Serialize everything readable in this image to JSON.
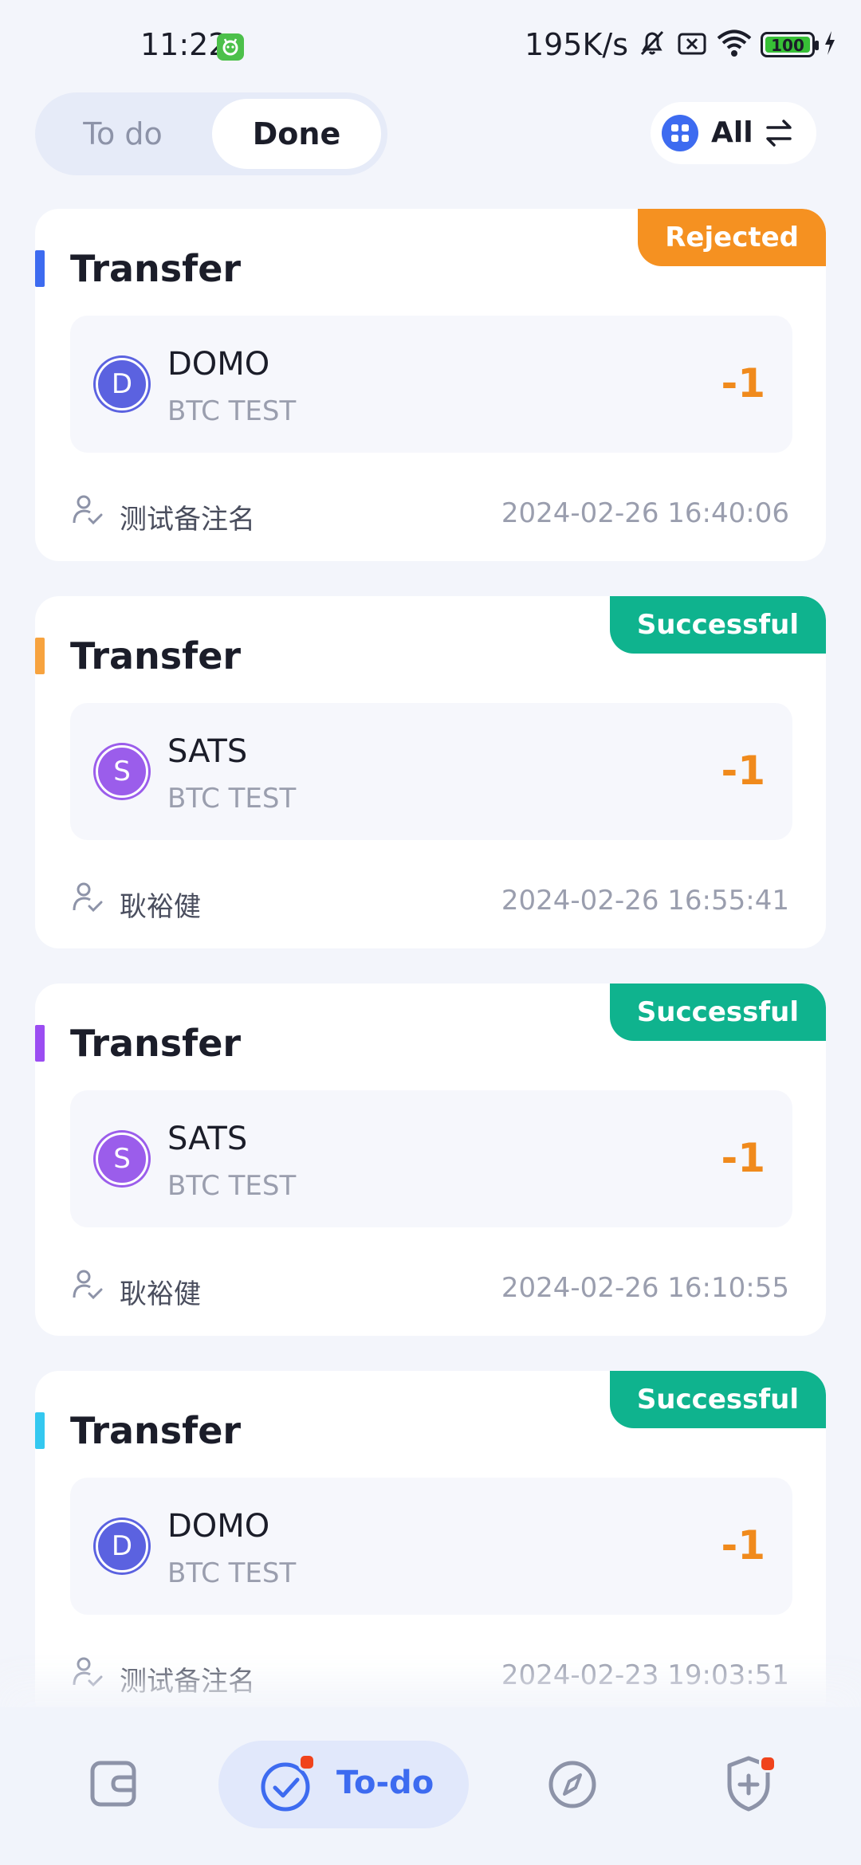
{
  "status_bar": {
    "time": "11:22",
    "net_speed": "195K/s",
    "battery": "100",
    "icons": [
      "app-notification-icon",
      "mute-icon",
      "sim-off-icon",
      "wifi-icon",
      "battery-icon",
      "charging-icon"
    ]
  },
  "tabs": {
    "todo": "To do",
    "done": "Done",
    "active": "Done"
  },
  "filter": {
    "label": "All"
  },
  "colors": {
    "rejected": "#F59121",
    "successful": "#0FB38E",
    "primary": "#3D6BF0",
    "amount": "#F08A1C"
  },
  "cards": [
    {
      "title": "Transfer",
      "status": "Rejected",
      "accent": "#3D6BF0",
      "token_letter": "D",
      "token_color": "#5B62E0",
      "asset": "DOMO",
      "network": "BTC TEST",
      "amount": "-1",
      "user": "测试备注名",
      "time": "2024-02-26 16:40:06"
    },
    {
      "title": "Transfer",
      "status": "Successful",
      "accent": "#F7A33F",
      "token_letter": "S",
      "token_color": "#9B5DEB",
      "asset": "SATS",
      "network": "BTC TEST",
      "amount": "-1",
      "user": "耿裕健",
      "time": "2024-02-26 16:55:41"
    },
    {
      "title": "Transfer",
      "status": "Successful",
      "accent": "#9B4DF2",
      "token_letter": "S",
      "token_color": "#9B5DEB",
      "asset": "SATS",
      "network": "BTC TEST",
      "amount": "-1",
      "user": "耿裕健",
      "time": "2024-02-26 16:10:55"
    },
    {
      "title": "Transfer",
      "status": "Successful",
      "accent": "#34C8F0",
      "token_letter": "D",
      "token_color": "#5B62E0",
      "asset": "DOMO",
      "network": "BTC TEST",
      "amount": "-1",
      "user": "测试备注名",
      "time": "2024-02-23 19:03:51"
    }
  ],
  "bottom_nav": {
    "active_label": "To-do"
  }
}
